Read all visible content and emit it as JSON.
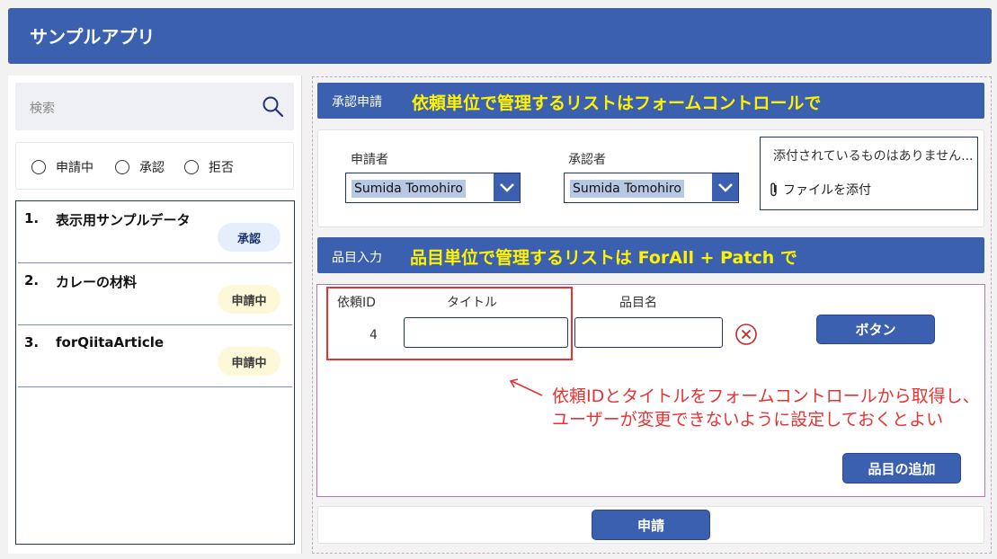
{
  "app": {
    "title": "サンプルアプリ"
  },
  "search": {
    "placeholder": "検索",
    "icon": "search-icon"
  },
  "status_filter": {
    "options": [
      "申請中",
      "承認",
      "拒否"
    ]
  },
  "requests": [
    {
      "num": "1.",
      "title": "表示用サンプルデータ",
      "status": "承認"
    },
    {
      "num": "2.",
      "title": "カレーの材料",
      "status": "申請中"
    },
    {
      "num": "3.",
      "title": "forQiitaArticle",
      "status": "申請中"
    }
  ],
  "approval": {
    "section_label": "承認申請",
    "annotation": "依頼単位で管理するリストはフォームコントロールで",
    "applicant_label": "申請者",
    "applicant_value": "Sumida Tomohiro",
    "approver_label": "承認者",
    "approver_value": "Sumida Tomohiro",
    "attachments_empty": "添付されているものはありません...",
    "attach_label": "ファイルを添付"
  },
  "items": {
    "section_label": "品目入力",
    "annotation": "品目単位で管理するリストは ForAll + Patch で",
    "col_request_id": "依頼ID",
    "col_title": "タイトル",
    "col_item_name": "品目名",
    "row": {
      "request_id": "4",
      "title": "",
      "item_name": ""
    },
    "button_label": "ボタン",
    "add_item_label": "品目の追加",
    "note_line1": "依頼IDとタイトルをフォームコントロールから取得し、",
    "note_line2": "ユーザーが変更できないように設定しておくとよい"
  },
  "submit": {
    "label": "申請"
  },
  "colors": {
    "brand": "#3c60b0",
    "dark_navy": "#1f3370",
    "annotation_yellow": "#fff200",
    "annotation_red": "#e53232"
  }
}
